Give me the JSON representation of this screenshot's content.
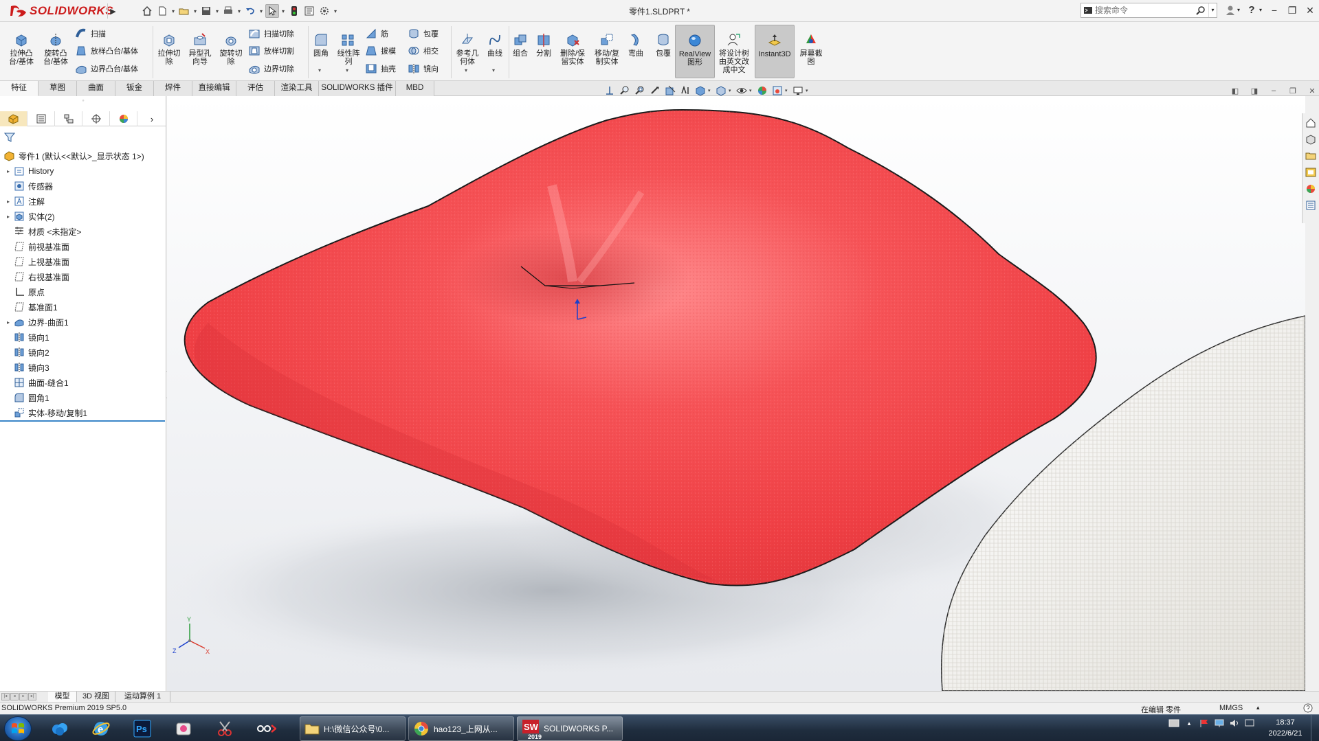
{
  "app": {
    "brand": "SOLIDWORKS",
    "doc_title": "零件1.SLDPRT *",
    "search_placeholder": "搜索命令",
    "help_label": "?"
  },
  "ribbon": {
    "extrude_boss": "拉伸凸\n台/基体",
    "revolve_boss": "旋转凸\n台/基体",
    "sweep": "扫描",
    "loft_boss": "放样凸台/基体",
    "boundary_boss": "边界凸台/基体",
    "extrude_cut": "拉伸切\n除",
    "hole_wizard": "异型孔\n向导",
    "revolve_cut": "旋转切\n除",
    "swept_cut": "扫描切除",
    "lofted_cut": "放样切割",
    "boundary_cut": "边界切除",
    "fillet": "圆角",
    "linear_pattern": "线性阵\n列",
    "rib": "筋",
    "draft": "拔模",
    "shell": "抽壳",
    "wrap": "包覆",
    "intersect": "相交",
    "mirror": "镜向",
    "ref_geometry": "参考几\n何体",
    "curves": "曲线",
    "combine": "组合",
    "split": "分割",
    "delete_keep_body": "删除/保\n留实体",
    "move_copy_body": "移动/复\n制实体",
    "flex": "弯曲",
    "wrap2": "包覆",
    "realview": "RealView\n图形",
    "translate_tree": "将设计树\n由英文改\n成中文",
    "instant3d": "Instant3D",
    "screen_capture": "屏幕截\n图"
  },
  "cm_tabs": [
    "特征",
    "草图",
    "曲面",
    "钣金",
    "焊件",
    "直接编辑",
    "评估",
    "渲染工具",
    "SOLIDWORKS 插件",
    "MBD"
  ],
  "feature_tree": {
    "root": "零件1 (默认<<默认>_显示状态 1>)",
    "items": [
      {
        "label": "History",
        "icon": "history-icon",
        "expandable": true
      },
      {
        "label": "传感器",
        "icon": "sensor-icon",
        "expandable": false
      },
      {
        "label": "注解",
        "icon": "annotation-icon",
        "expandable": true
      },
      {
        "label": "实体(2)",
        "icon": "solid-bodies-icon",
        "expandable": true
      },
      {
        "label": "材质 <未指定>",
        "icon": "material-icon",
        "expandable": false
      },
      {
        "label": "前视基准面",
        "icon": "plane-icon",
        "expandable": false
      },
      {
        "label": "上视基准面",
        "icon": "plane-icon",
        "expandable": false
      },
      {
        "label": "右视基准面",
        "icon": "plane-icon",
        "expandable": false
      },
      {
        "label": "原点",
        "icon": "origin-icon",
        "expandable": false
      },
      {
        "label": "基准面1",
        "icon": "plane-icon",
        "expandable": false
      },
      {
        "label": "边界-曲面1",
        "icon": "boundary-surface-icon",
        "expandable": true
      },
      {
        "label": "镜向1",
        "icon": "mirror-icon",
        "expandable": false
      },
      {
        "label": "镜向2",
        "icon": "mirror-icon",
        "expandable": false
      },
      {
        "label": "镜向3",
        "icon": "mirror-icon",
        "expandable": false
      },
      {
        "label": "曲面-缝合1",
        "icon": "knit-surface-icon",
        "expandable": false
      },
      {
        "label": "圆角1",
        "icon": "fillet-icon",
        "expandable": false
      },
      {
        "label": "实体-移动/复制1",
        "icon": "move-copy-icon",
        "expandable": false
      }
    ]
  },
  "bottom_tabs": [
    "模型",
    "3D 视图",
    "运动算例 1"
  ],
  "status": {
    "product": "SOLIDWORKS Premium 2019 SP5.0",
    "editing": "在编辑 零件",
    "units": "MMGS"
  },
  "taskbar": {
    "items": [
      {
        "label": "H:\\微信公众号\\0...",
        "icon": "folder-icon"
      },
      {
        "label": "hao123_上网从...",
        "icon": "browser-icon"
      },
      {
        "label": "SOLIDWORKS P...",
        "icon": "solidworks-icon"
      }
    ],
    "sw_badge": "2019",
    "time": "18:37",
    "date": "2022/6/21"
  },
  "colors": {
    "brand_red": "#cc1b1b",
    "pillow_red": "#f0484c",
    "cloth_white": "#f1f0ec"
  }
}
